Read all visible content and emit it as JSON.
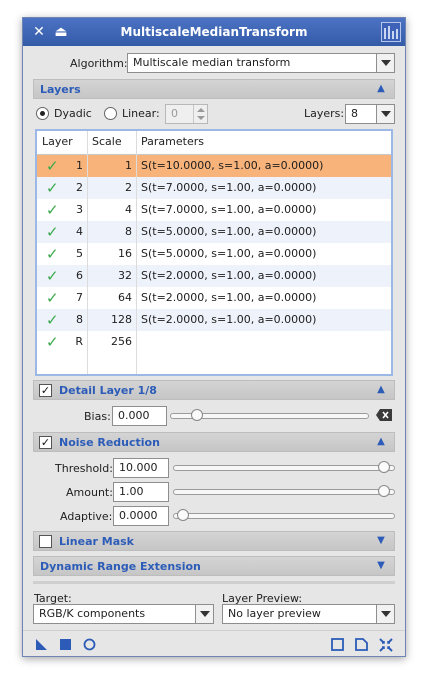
{
  "window": {
    "title": "MultiscaleMedianTransform"
  },
  "algorithm": {
    "label": "Algorithm:",
    "value": "Multiscale median transform"
  },
  "layers_section": {
    "title": "Layers"
  },
  "layers_opts": {
    "dyadic_label": "Dyadic",
    "linear_label": "Linear:",
    "linear_value": "0",
    "layers_label": "Layers:",
    "layers_value": "8"
  },
  "table": {
    "headers": [
      "Layer",
      "Scale",
      "Parameters"
    ],
    "rows": [
      {
        "layer": "1",
        "scale": "1",
        "params": "S(t=10.0000, s=1.00, a=0.0000)"
      },
      {
        "layer": "2",
        "scale": "2",
        "params": "S(t=7.0000, s=1.00, a=0.0000)"
      },
      {
        "layer": "3",
        "scale": "4",
        "params": "S(t=7.0000, s=1.00, a=0.0000)"
      },
      {
        "layer": "4",
        "scale": "8",
        "params": "S(t=5.0000, s=1.00, a=0.0000)"
      },
      {
        "layer": "5",
        "scale": "16",
        "params": "S(t=5.0000, s=1.00, a=0.0000)"
      },
      {
        "layer": "6",
        "scale": "32",
        "params": "S(t=2.0000, s=1.00, a=0.0000)"
      },
      {
        "layer": "7",
        "scale": "64",
        "params": "S(t=2.0000, s=1.00, a=0.0000)"
      },
      {
        "layer": "8",
        "scale": "128",
        "params": "S(t=2.0000, s=1.00, a=0.0000)"
      },
      {
        "layer": "R",
        "scale": "256",
        "params": ""
      }
    ]
  },
  "detail_layer": {
    "title": "Detail Layer 1/8",
    "bias_label": "Bias:",
    "bias_value": "0.000"
  },
  "noise_reduction": {
    "title": "Noise Reduction",
    "threshold_label": "Threshold:",
    "threshold_value": "10.000",
    "amount_label": "Amount:",
    "amount_value": "1.00",
    "adaptive_label": "Adaptive:",
    "adaptive_value": "0.0000"
  },
  "linear_mask": {
    "title": "Linear Mask"
  },
  "dynamic_range": {
    "title": "Dynamic Range Extension"
  },
  "target": {
    "label": "Target:",
    "value": "RGB/K components"
  },
  "layer_preview": {
    "label": "Layer Preview:",
    "value": "No layer preview"
  },
  "colors": {
    "accent": "#2c5cb8",
    "selection": "#f7b37a",
    "check": "#3aa94a",
    "titlebar": "#3e64b4"
  }
}
